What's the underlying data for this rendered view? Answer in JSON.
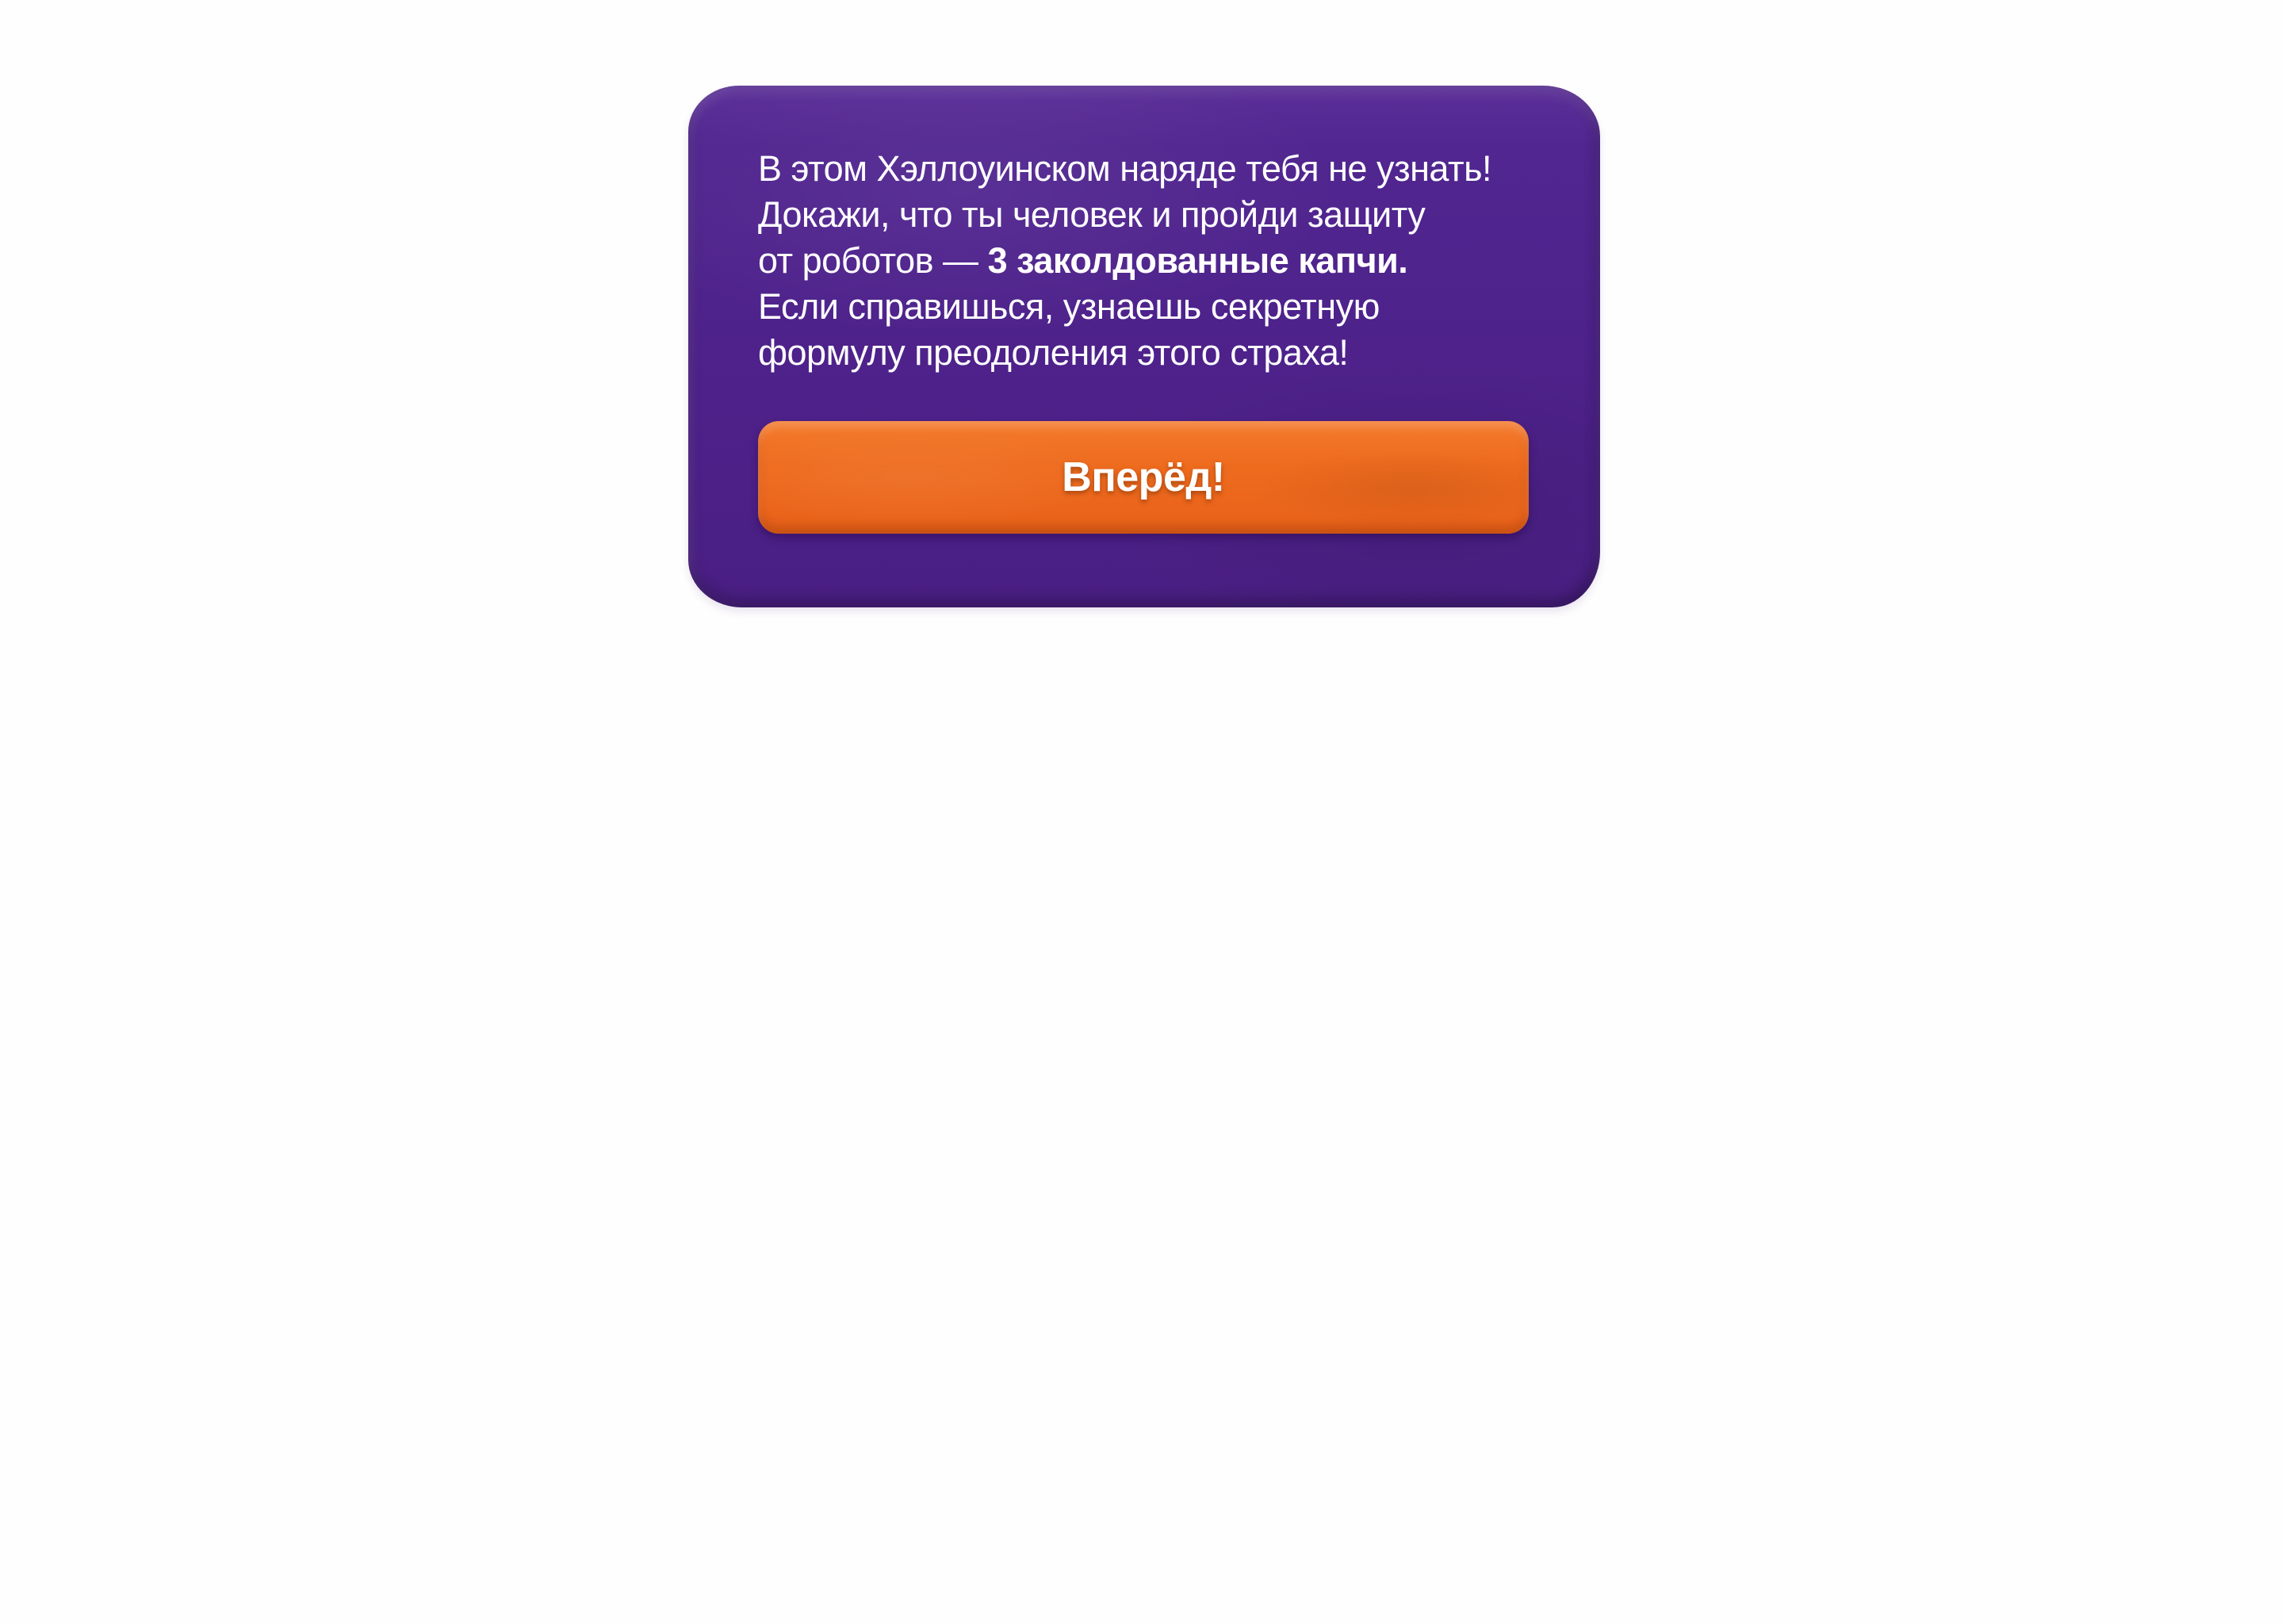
{
  "card": {
    "message_lines": [
      "В этом Хэллоуинском наряде тебя не узнать!",
      "Докажи, что ты человек и пройди защиту",
      "от роботов — ",
      "Если справишься, узнаешь секретную",
      "формулу преодоления этого страха!"
    ],
    "message_bold": "3 заколдованные капчи.",
    "button_label": "Вперёд!"
  },
  "colors": {
    "card_purple": "#4d2189",
    "button_orange": "#ee6b1e",
    "text": "#ffffff",
    "background": "#fefefe"
  }
}
